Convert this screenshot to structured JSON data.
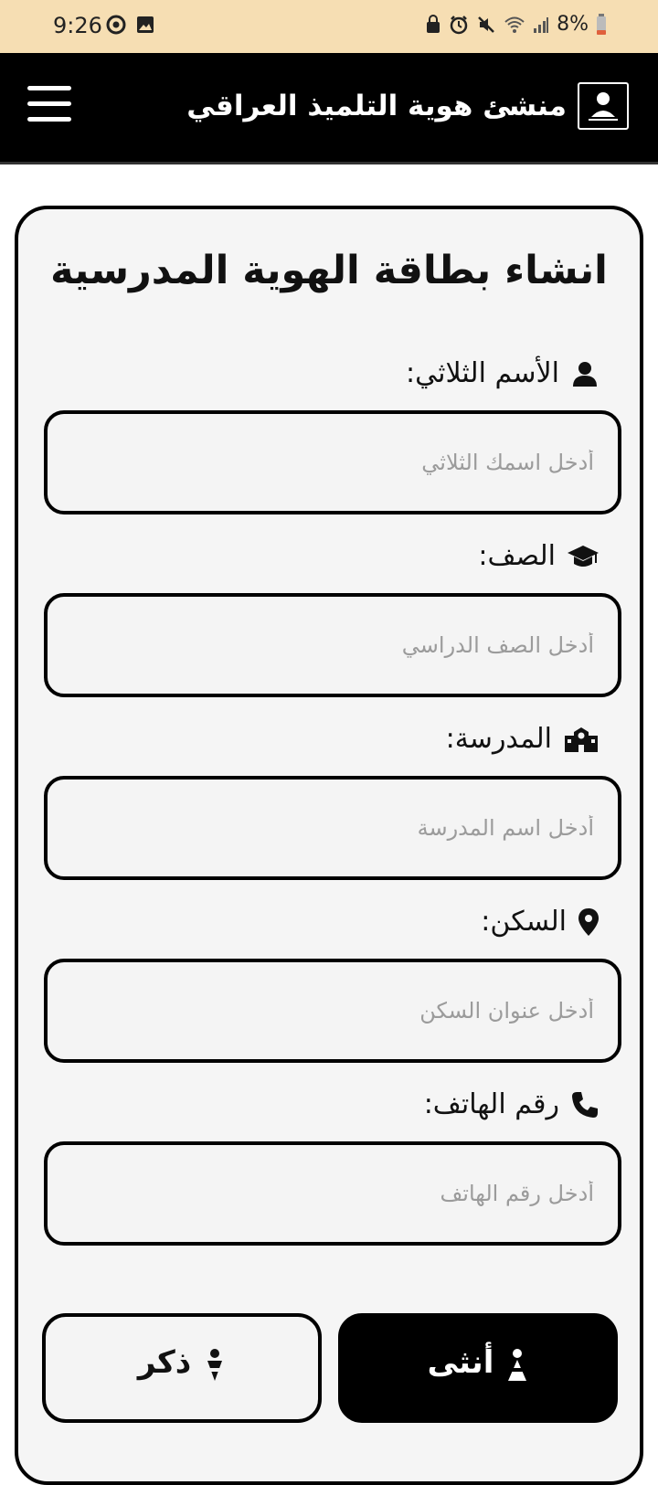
{
  "status_bar": {
    "time": "9:26",
    "battery": "8%"
  },
  "app_bar": {
    "title": "منشئ هوية التلميذ العراقي"
  },
  "form": {
    "title": "انشاء بطاقة الهوية المدرسية",
    "fields": [
      {
        "label": "الأسم الثلاثي:",
        "placeholder": "أدخل اسمك الثلاثي",
        "icon": "user-icon"
      },
      {
        "label": "الصف:",
        "placeholder": "أدخل الصف الدراسي",
        "icon": "graduation-cap-icon"
      },
      {
        "label": "المدرسة:",
        "placeholder": "أدخل اسم المدرسة",
        "icon": "school-icon"
      },
      {
        "label": "السكن:",
        "placeholder": "أدخل عنوان السكن",
        "icon": "location-pin-icon"
      },
      {
        "label": "رقم الهاتف:",
        "placeholder": "أدخل رقم الهاتف",
        "icon": "phone-icon"
      }
    ],
    "gender": {
      "female_label": "أنثى",
      "male_label": "ذكر",
      "selected": "female"
    }
  },
  "colors": {
    "status_bar_bg": "#f6deb3",
    "app_bar_bg": "#000000",
    "card_bg": "#f5f5f5",
    "placeholder": "#9b9b9b"
  }
}
